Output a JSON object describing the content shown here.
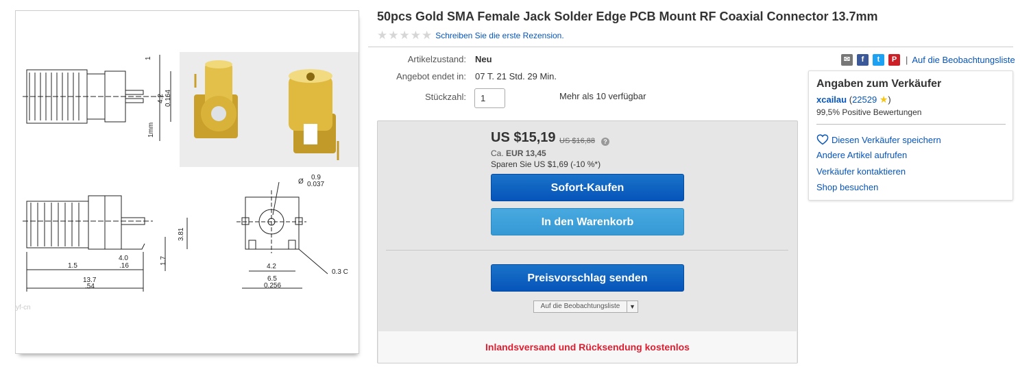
{
  "image": {
    "watermark": "yf-cn"
  },
  "drawing": {
    "top_dims": [
      "1",
      "4.2",
      "0.164",
      "1mm"
    ],
    "bottom_dims": [
      "1.5",
      "4.0",
      ".16",
      "1.7",
      "3.81",
      "13.7",
      ".54"
    ],
    "footprint_dims": [
      "Ø",
      "0.9",
      "0.037",
      "4.2",
      "6.5",
      "0.256",
      "0.3 C"
    ]
  },
  "title": "50pcs Gold SMA Female Jack Solder Edge PCB Mount RF Coaxial Connector 13.7mm",
  "rating": {
    "stars": [
      "★",
      "★",
      "★",
      "★",
      "★"
    ],
    "review_link": "Schreiben Sie die erste Rezension."
  },
  "details": {
    "condition_label": "Artikelzustand:",
    "condition_value": "Neu",
    "ends_label": "Angebot endet in:",
    "ends_value": "07 T. 21 Std. 29 Min.",
    "quantity_label": "Stückzahl:",
    "quantity_value": "1",
    "availability": "Mehr als 10 verfügbar"
  },
  "buybox": {
    "price": "US $15,19",
    "old_price": "US $16,88",
    "help": "?",
    "approx_prefix": "Ca.",
    "approx_value": "EUR 13,45",
    "savings": "Sparen Sie US $1,69 (-10 %*)",
    "buy_now": "Sofort-Kaufen",
    "add_to_cart": "In den Warenkorb",
    "make_offer": "Preisvorschlag senden",
    "watch_select": "Auf die Beobachtungsliste",
    "shipping": "Inlandsversand und Rücksendung kostenlos"
  },
  "share": {
    "icons": [
      "mail-icon",
      "facebook-icon",
      "twitter-icon",
      "pinterest-icon"
    ],
    "icon_glyphs": {
      "mail": "✉",
      "facebook": "f",
      "twitter": "t",
      "pinterest": "P"
    },
    "separator": "|",
    "watch_link": "Auf die Beobachtungsliste"
  },
  "seller": {
    "heading": "Angaben zum Verkäufer",
    "name": "xcailau",
    "open_paren": "(",
    "feedback_score": "22529",
    "star": "★",
    "close_paren": ")",
    "positive": "99,5% Positive Bewertungen",
    "save_seller": "Diesen Verkäufer speichern",
    "other_items": "Andere Artikel aufrufen",
    "contact": "Verkäufer kontaktieren",
    "visit_shop": "Shop besuchen"
  },
  "colors": {
    "link": "#0654ba",
    "buy_button": "#0654ba",
    "cart_button": "#3699d4",
    "shipping_text": "#dd1e31"
  }
}
